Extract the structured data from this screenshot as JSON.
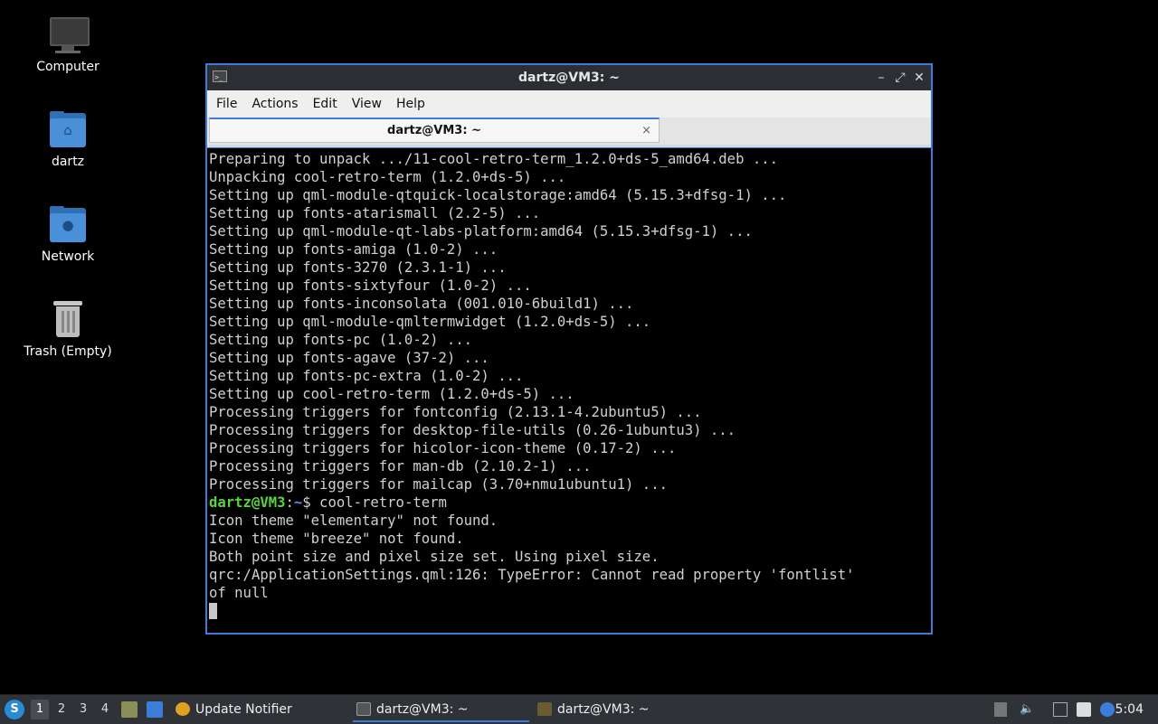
{
  "desktop": {
    "icons": [
      {
        "label": "Computer",
        "icon": "computer-icon"
      },
      {
        "label": "dartz",
        "icon": "home-folder-icon"
      },
      {
        "label": "Network",
        "icon": "network-folder-icon"
      },
      {
        "label": "Trash (Empty)",
        "icon": "trash-icon"
      }
    ]
  },
  "window": {
    "title": "dartz@VM3: ~",
    "menu": [
      "File",
      "Actions",
      "Edit",
      "View",
      "Help"
    ],
    "tab": {
      "label": "dartz@VM3: ~",
      "close": "×"
    },
    "controls": {
      "minimize": "–",
      "maximize": "⤢",
      "close": "✕"
    }
  },
  "terminal": {
    "lines": [
      "Preparing to unpack .../11-cool-retro-term_1.2.0+ds-5_amd64.deb ...",
      "Unpacking cool-retro-term (1.2.0+ds-5) ...",
      "Setting up qml-module-qtquick-localstorage:amd64 (5.15.3+dfsg-1) ...",
      "Setting up fonts-atarismall (2.2-5) ...",
      "Setting up qml-module-qt-labs-platform:amd64 (5.15.3+dfsg-1) ...",
      "Setting up fonts-amiga (1.0-2) ...",
      "Setting up fonts-3270 (2.3.1-1) ...",
      "Setting up fonts-sixtyfour (1.0-2) ...",
      "Setting up fonts-inconsolata (001.010-6build1) ...",
      "Setting up qml-module-qmltermwidget (1.2.0+ds-5) ...",
      "Setting up fonts-pc (1.0-2) ...",
      "Setting up fonts-agave (37-2) ...",
      "Setting up fonts-pc-extra (1.0-2) ...",
      "Setting up cool-retro-term (1.2.0+ds-5) ...",
      "Processing triggers for fontconfig (2.13.1-4.2ubuntu5) ...",
      "Processing triggers for desktop-file-utils (0.26-1ubuntu3) ...",
      "Processing triggers for hicolor-icon-theme (0.17-2) ...",
      "Processing triggers for man-db (2.10.2-1) ...",
      "Processing triggers for mailcap (3.70+nmu1ubuntu1) ..."
    ],
    "prompt": {
      "user_host": "dartz@VM3",
      "sep": ":",
      "path": "~",
      "symbol": "$",
      "command": " cool-retro-term"
    },
    "output": [
      "Icon theme \"elementary\" not found.",
      "Icon theme \"breeze\" not found.",
      "Both point size and pixel size set. Using pixel size.",
      "qrc:/ApplicationSettings.qml:126: TypeError: Cannot read property 'fontlist'",
      "of null"
    ]
  },
  "taskbar": {
    "workspaces": [
      "1",
      "2",
      "3",
      "4"
    ],
    "active_workspace": "1",
    "tasks": [
      {
        "label": "Update Notifier",
        "icon": "update-notifier-icon"
      },
      {
        "label": "dartz@VM3: ~",
        "icon": "terminal-icon",
        "active": true
      },
      {
        "label": "dartz@VM3: ~",
        "icon": "cool-retro-term-icon"
      }
    ],
    "clock": "5:04"
  }
}
